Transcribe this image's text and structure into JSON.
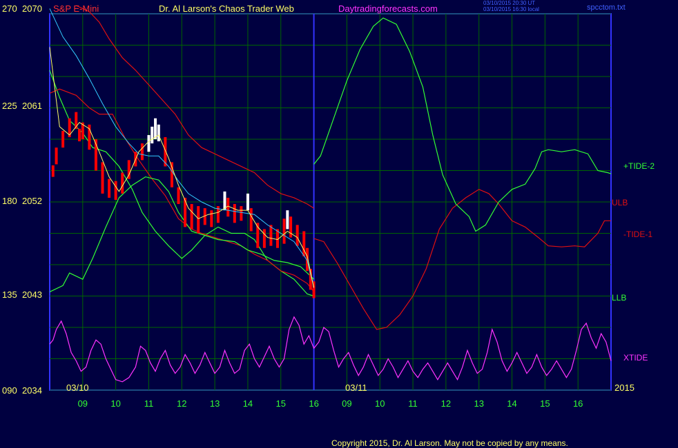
{
  "header": {
    "instrument": "S&P E-Mini",
    "title": "Dr. Al Larson's Chaos Trader Web",
    "site": "Daytradingforecasts.com",
    "stamp1": "03/10/2015 20:30 UT",
    "stamp2": "03/10/2015 16:30 local",
    "file": "spcctom.txt"
  },
  "colors": {
    "background": "#000040",
    "frame": "#3333ff",
    "grid": "#006600",
    "price_up": "#ffffff",
    "price_down": "#ff0000",
    "ma_fast": "#ffff66",
    "ma_slow": "#33ccff",
    "tide2": "#33ff33",
    "tide1": "#e01010",
    "xtide": "#ff33ff"
  },
  "footer": {
    "copyright": "Copyright 2015, Dr. Al Larson. May not be copied by any means."
  },
  "chart_data": {
    "type": "line",
    "title": "S&P E-Mini",
    "x_ticks": [
      "09",
      "10",
      "11",
      "12",
      "13",
      "14",
      "15",
      "16",
      "09",
      "10",
      "11",
      "12",
      "13",
      "14",
      "15",
      "16"
    ],
    "date_labels": [
      "03/10",
      "03/11"
    ],
    "year_label": "2015",
    "y_left_scale": [
      "270",
      "225",
      "180",
      "135",
      "090"
    ],
    "y_right_scale": [
      "2070",
      "2061",
      "2052",
      "2043",
      "2034"
    ],
    "ylim": [
      2034,
      2070
    ],
    "series_labels": {
      "tide2": "+TIDE-2",
      "ulb": "ULB",
      "tide1": "-TIDE-1",
      "llb": "LLB",
      "xtide": "XTIDE"
    },
    "grid": true,
    "price_bars": [
      [
        8.1,
        2055.5,
        2054.4,
        "down"
      ],
      [
        8.2,
        2057.2,
        2055.6,
        "down"
      ],
      [
        8.4,
        2058.8,
        2057.2,
        "down"
      ],
      [
        8.6,
        2060.0,
        2058.2,
        "down"
      ],
      [
        8.8,
        2060.6,
        2059.0,
        "down"
      ],
      [
        8.9,
        2059.0,
        2057.8,
        "down"
      ],
      [
        9.0,
        2059.6,
        2058.0,
        "down"
      ],
      [
        9.2,
        2059.4,
        2057.0,
        "down"
      ],
      [
        9.4,
        2058.0,
        2055.0,
        "down"
      ],
      [
        9.6,
        2055.8,
        2052.8,
        "down"
      ],
      [
        9.8,
        2054.2,
        2052.4,
        "down"
      ],
      [
        10.0,
        2054.0,
        2052.2,
        "down"
      ],
      [
        10.2,
        2054.8,
        2052.8,
        "down"
      ],
      [
        10.4,
        2056.0,
        2054.2,
        "down"
      ],
      [
        10.6,
        2056.8,
        2055.4,
        "down"
      ],
      [
        10.8,
        2057.6,
        2056.0,
        "down"
      ],
      [
        11.0,
        2058.4,
        2056.8,
        "up"
      ],
      [
        11.1,
        2059.2,
        2057.6,
        "up"
      ],
      [
        11.2,
        2060.0,
        2058.0,
        "up"
      ],
      [
        11.3,
        2059.4,
        2057.8,
        "up"
      ],
      [
        11.5,
        2058.2,
        2055.4,
        "down"
      ],
      [
        11.7,
        2055.8,
        2053.4,
        "down"
      ],
      [
        11.9,
        2053.4,
        2051.8,
        "down"
      ],
      [
        12.1,
        2052.4,
        2049.6,
        "down"
      ],
      [
        12.3,
        2051.8,
        2049.4,
        "down"
      ],
      [
        12.5,
        2051.6,
        2049.0,
        "down"
      ],
      [
        12.7,
        2051.4,
        2049.8,
        "down"
      ],
      [
        12.9,
        2051.2,
        2049.6,
        "down"
      ],
      [
        13.1,
        2051.6,
        2050.0,
        "down"
      ],
      [
        13.3,
        2053.0,
        2051.2,
        "up"
      ],
      [
        13.4,
        2052.4,
        2050.6,
        "down"
      ],
      [
        13.6,
        2051.8,
        2050.0,
        "down"
      ],
      [
        13.8,
        2051.6,
        2050.2,
        "down"
      ],
      [
        14.0,
        2052.8,
        2051.2,
        "up"
      ],
      [
        14.1,
        2051.4,
        2049.2,
        "down"
      ],
      [
        14.3,
        2050.0,
        2047.6,
        "down"
      ],
      [
        14.5,
        2049.4,
        2047.6,
        "down"
      ],
      [
        14.7,
        2049.8,
        2047.8,
        "down"
      ],
      [
        14.9,
        2049.4,
        2047.6,
        "down"
      ],
      [
        15.1,
        2050.4,
        2048.0,
        "down"
      ],
      [
        15.2,
        2051.2,
        2049.4,
        "up"
      ],
      [
        15.3,
        2050.6,
        2048.6,
        "down"
      ],
      [
        15.5,
        2049.8,
        2047.8,
        "down"
      ],
      [
        15.7,
        2049.2,
        2046.8,
        "down"
      ],
      [
        15.8,
        2047.6,
        2045.4,
        "down"
      ],
      [
        15.9,
        2045.6,
        2043.6,
        "down"
      ],
      [
        16.0,
        2044.4,
        2042.8,
        "down"
      ]
    ],
    "ma_fast": [
      [
        8.0,
        2066.8
      ],
      [
        8.3,
        2059.2
      ],
      [
        8.6,
        2058.4
      ],
      [
        8.9,
        2059.6
      ],
      [
        9.2,
        2059.0
      ],
      [
        9.5,
        2056.8
      ],
      [
        9.8,
        2054.4
      ],
      [
        10.1,
        2053.0
      ],
      [
        10.4,
        2054.6
      ],
      [
        10.7,
        2056.8
      ],
      [
        11.0,
        2057.8
      ],
      [
        11.3,
        2058.4
      ],
      [
        11.6,
        2056.2
      ],
      [
        11.9,
        2053.6
      ],
      [
        12.2,
        2051.4
      ],
      [
        12.5,
        2050.4
      ],
      [
        12.8,
        2050.8
      ],
      [
        13.1,
        2051.0
      ],
      [
        13.4,
        2051.6
      ],
      [
        13.7,
        2051.2
      ],
      [
        14.0,
        2051.2
      ],
      [
        14.3,
        2049.6
      ],
      [
        14.6,
        2048.6
      ],
      [
        14.9,
        2048.4
      ],
      [
        15.2,
        2049.2
      ],
      [
        15.5,
        2048.6
      ],
      [
        15.8,
        2046.8
      ],
      [
        16.0,
        2043.8
      ]
    ],
    "ma_slow": [
      [
        8.0,
        2070.5
      ],
      [
        8.4,
        2067.8
      ],
      [
        8.8,
        2066.0
      ],
      [
        9.2,
        2063.8
      ],
      [
        9.6,
        2061.4
      ],
      [
        10.0,
        2059.2
      ],
      [
        10.4,
        2057.6
      ],
      [
        10.7,
        2056.6
      ],
      [
        11.0,
        2056.4
      ],
      [
        11.3,
        2056.4
      ],
      [
        11.6,
        2055.4
      ],
      [
        11.9,
        2054.0
      ],
      [
        12.2,
        2052.8
      ],
      [
        12.6,
        2052.0
      ],
      [
        13.0,
        2051.4
      ],
      [
        13.4,
        2051.2
      ],
      [
        13.8,
        2051.0
      ],
      [
        14.2,
        2050.8
      ],
      [
        14.6,
        2049.8
      ],
      [
        15.0,
        2049.0
      ],
      [
        15.4,
        2048.2
      ],
      [
        15.8,
        2046.4
      ],
      [
        16.0,
        2043.8
      ]
    ],
    "tide2": [
      [
        8.0,
        2043.4
      ],
      [
        8.4,
        2044.0
      ],
      [
        8.6,
        2045.2
      ],
      [
        9.0,
        2044.6
      ],
      [
        9.3,
        2046.6
      ],
      [
        9.7,
        2049.6
      ],
      [
        10.1,
        2052.4
      ],
      [
        10.5,
        2053.6
      ],
      [
        10.9,
        2054.4
      ],
      [
        11.3,
        2054.1
      ],
      [
        11.6,
        2053.0
      ],
      [
        11.9,
        2051.0
      ],
      [
        12.3,
        2049.2
      ],
      [
        12.7,
        2048.8
      ],
      [
        13.1,
        2048.4
      ],
      [
        13.6,
        2048.2
      ],
      [
        14.0,
        2047.4
      ],
      [
        14.4,
        2047.0
      ],
      [
        14.8,
        2046.4
      ],
      [
        15.2,
        2046.2
      ],
      [
        15.6,
        2045.8
      ],
      [
        16.0,
        2044.6
      ],
      [
        16.0,
        2055.6
      ],
      [
        16.2,
        2056.4
      ],
      [
        16.6,
        2060.0
      ],
      [
        17.0,
        2063.6
      ],
      [
        17.4,
        2066.6
      ],
      [
        17.8,
        2068.8
      ],
      [
        18.1,
        2069.6
      ],
      [
        18.5,
        2069.0
      ],
      [
        18.9,
        2066.4
      ],
      [
        19.3,
        2063.0
      ],
      [
        19.6,
        2058.4
      ],
      [
        19.9,
        2054.6
      ],
      [
        20.3,
        2051.8
      ],
      [
        20.7,
        2050.6
      ],
      [
        20.9,
        2049.2
      ],
      [
        21.2,
        2049.8
      ],
      [
        21.6,
        2052.0
      ],
      [
        22.0,
        2053.2
      ],
      [
        22.4,
        2053.7
      ],
      [
        22.7,
        2055.2
      ],
      [
        22.9,
        2056.8
      ],
      [
        23.1,
        2057.0
      ],
      [
        23.5,
        2056.8
      ],
      [
        23.9,
        2057.0
      ],
      [
        24.3,
        2056.6
      ],
      [
        24.6,
        2055.0
      ],
      [
        24.9,
        2054.8
      ],
      [
        25.0,
        2054.7
      ]
    ],
    "tide1": [
      [
        8.0,
        2062.4
      ],
      [
        8.3,
        2062.8
      ],
      [
        8.8,
        2062.2
      ],
      [
        9.2,
        2061.0
      ],
      [
        9.5,
        2060.4
      ],
      [
        9.9,
        2060.4
      ],
      [
        10.3,
        2058.0
      ],
      [
        10.7,
        2056.0
      ],
      [
        11.1,
        2054.2
      ],
      [
        11.5,
        2052.6
      ],
      [
        11.9,
        2050.4
      ],
      [
        12.3,
        2049.4
      ],
      [
        12.6,
        2049.0
      ],
      [
        13.0,
        2048.6
      ],
      [
        13.4,
        2048.2
      ],
      [
        13.8,
        2047.8
      ],
      [
        14.2,
        2047.0
      ],
      [
        14.6,
        2046.4
      ],
      [
        15.0,
        2045.4
      ],
      [
        15.4,
        2045.0
      ],
      [
        15.8,
        2044.2
      ],
      [
        16.0,
        2043.4
      ],
      [
        16.0,
        2048.5
      ],
      [
        16.3,
        2048.2
      ],
      [
        16.7,
        2046.2
      ],
      [
        17.1,
        2044.0
      ],
      [
        17.5,
        2041.8
      ],
      [
        17.9,
        2039.8
      ],
      [
        18.2,
        2040.0
      ],
      [
        18.6,
        2041.2
      ],
      [
        19.0,
        2043.0
      ],
      [
        19.4,
        2045.6
      ],
      [
        19.8,
        2049.4
      ],
      [
        20.2,
        2051.4
      ],
      [
        20.6,
        2052.4
      ],
      [
        21.0,
        2053.2
      ],
      [
        21.3,
        2052.8
      ],
      [
        21.6,
        2051.8
      ],
      [
        22.0,
        2050.2
      ],
      [
        22.4,
        2049.6
      ],
      [
        22.8,
        2048.6
      ],
      [
        23.1,
        2047.8
      ],
      [
        23.5,
        2047.7
      ],
      [
        23.9,
        2047.8
      ],
      [
        24.2,
        2047.7
      ],
      [
        24.6,
        2049.0
      ],
      [
        24.8,
        2050.2
      ],
      [
        25.0,
        2050.2
      ]
    ],
    "ulb": [
      [
        8.8,
        2070.8
      ],
      [
        9.2,
        2070.2
      ],
      [
        9.5,
        2069.2
      ],
      [
        9.8,
        2067.6
      ],
      [
        10.2,
        2065.8
      ],
      [
        10.6,
        2064.6
      ],
      [
        11.0,
        2063.2
      ],
      [
        11.4,
        2061.8
      ],
      [
        11.8,
        2060.4
      ],
      [
        12.2,
        2058.4
      ],
      [
        12.6,
        2057.2
      ],
      [
        13.0,
        2056.6
      ],
      [
        13.4,
        2056.0
      ],
      [
        13.8,
        2055.4
      ],
      [
        14.2,
        2054.8
      ],
      [
        14.6,
        2053.6
      ],
      [
        15.0,
        2052.8
      ],
      [
        15.4,
        2052.4
      ],
      [
        15.8,
        2051.8
      ],
      [
        16.0,
        2051.4
      ]
    ],
    "llb": [
      [
        8.0,
        2064.6
      ],
      [
        8.3,
        2062.0
      ],
      [
        8.6,
        2059.8
      ],
      [
        9.0,
        2058.6
      ],
      [
        9.3,
        2057.2
      ],
      [
        9.7,
        2056.8
      ],
      [
        10.1,
        2055.4
      ],
      [
        10.5,
        2053.2
      ],
      [
        10.8,
        2051.0
      ],
      [
        11.2,
        2049.2
      ],
      [
        11.6,
        2047.8
      ],
      [
        12.0,
        2046.6
      ],
      [
        12.3,
        2047.4
      ],
      [
        12.7,
        2048.8
      ],
      [
        13.1,
        2049.6
      ],
      [
        13.5,
        2049.0
      ],
      [
        13.9,
        2049.0
      ],
      [
        14.2,
        2048.4
      ],
      [
        14.6,
        2046.4
      ],
      [
        15.0,
        2045.4
      ],
      [
        15.4,
        2044.6
      ],
      [
        15.8,
        2043.2
      ],
      [
        16.0,
        2043.0
      ]
    ],
    "xtide": [
      [
        8.0,
        2038.4
      ],
      [
        8.1,
        2038.8
      ],
      [
        8.2,
        2039.8
      ],
      [
        8.35,
        2040.6
      ],
      [
        8.5,
        2039.4
      ],
      [
        8.65,
        2037.6
      ],
      [
        8.8,
        2036.8
      ],
      [
        8.95,
        2035.8
      ],
      [
        9.1,
        2036.2
      ],
      [
        9.25,
        2037.8
      ],
      [
        9.4,
        2038.8
      ],
      [
        9.55,
        2038.4
      ],
      [
        9.7,
        2037.0
      ],
      [
        9.85,
        2036.0
      ],
      [
        10.0,
        2035.0
      ],
      [
        10.2,
        2034.8
      ],
      [
        10.4,
        2035.2
      ],
      [
        10.6,
        2036.2
      ],
      [
        10.75,
        2038.2
      ],
      [
        10.9,
        2037.8
      ],
      [
        11.05,
        2036.6
      ],
      [
        11.2,
        2035.8
      ],
      [
        11.35,
        2037.0
      ],
      [
        11.5,
        2037.8
      ],
      [
        11.65,
        2036.4
      ],
      [
        11.8,
        2035.6
      ],
      [
        11.95,
        2036.2
      ],
      [
        12.1,
        2037.4
      ],
      [
        12.25,
        2036.6
      ],
      [
        12.4,
        2035.6
      ],
      [
        12.55,
        2036.4
      ],
      [
        12.7,
        2037.6
      ],
      [
        12.85,
        2036.6
      ],
      [
        13.0,
        2035.6
      ],
      [
        13.15,
        2036.2
      ],
      [
        13.3,
        2037.8
      ],
      [
        13.45,
        2036.6
      ],
      [
        13.6,
        2035.6
      ],
      [
        13.75,
        2036.0
      ],
      [
        13.9,
        2037.8
      ],
      [
        14.05,
        2038.4
      ],
      [
        14.2,
        2037.0
      ],
      [
        14.35,
        2036.2
      ],
      [
        14.5,
        2037.2
      ],
      [
        14.65,
        2038.2
      ],
      [
        14.8,
        2037.0
      ],
      [
        14.95,
        2036.2
      ],
      [
        15.1,
        2037.0
      ],
      [
        15.25,
        2039.8
      ],
      [
        15.4,
        2041.0
      ],
      [
        15.55,
        2040.2
      ],
      [
        15.7,
        2038.4
      ],
      [
        15.85,
        2039.2
      ],
      [
        16.0,
        2038.0
      ],
      [
        16.15,
        2038.6
      ],
      [
        16.3,
        2040.0
      ],
      [
        16.45,
        2039.6
      ],
      [
        16.6,
        2037.8
      ],
      [
        16.75,
        2036.2
      ],
      [
        16.9,
        2037.0
      ],
      [
        17.05,
        2037.6
      ],
      [
        17.2,
        2036.4
      ],
      [
        17.35,
        2035.4
      ],
      [
        17.5,
        2036.2
      ],
      [
        17.65,
        2037.4
      ],
      [
        17.8,
        2036.4
      ],
      [
        17.95,
        2035.4
      ],
      [
        18.1,
        2036.0
      ],
      [
        18.25,
        2037.0
      ],
      [
        18.4,
        2036.2
      ],
      [
        18.55,
        2035.2
      ],
      [
        18.7,
        2036.0
      ],
      [
        18.85,
        2036.8
      ],
      [
        19.0,
        2035.8
      ],
      [
        19.15,
        2035.2
      ],
      [
        19.3,
        2036.0
      ],
      [
        19.45,
        2036.6
      ],
      [
        19.6,
        2035.8
      ],
      [
        19.75,
        2035.0
      ],
      [
        19.9,
        2035.8
      ],
      [
        20.05,
        2036.6
      ],
      [
        20.2,
        2035.8
      ],
      [
        20.35,
        2035.0
      ],
      [
        20.5,
        2036.2
      ],
      [
        20.65,
        2037.8
      ],
      [
        20.8,
        2036.6
      ],
      [
        20.95,
        2035.6
      ],
      [
        21.1,
        2036.0
      ],
      [
        21.25,
        2037.6
      ],
      [
        21.4,
        2039.8
      ],
      [
        21.55,
        2038.6
      ],
      [
        21.7,
        2036.8
      ],
      [
        21.85,
        2035.8
      ],
      [
        22.0,
        2036.6
      ],
      [
        22.15,
        2037.6
      ],
      [
        22.3,
        2036.6
      ],
      [
        22.45,
        2035.6
      ],
      [
        22.6,
        2036.2
      ],
      [
        22.75,
        2037.4
      ],
      [
        22.9,
        2036.2
      ],
      [
        23.05,
        2035.4
      ],
      [
        23.2,
        2036.0
      ],
      [
        23.35,
        2036.8
      ],
      [
        23.5,
        2036.0
      ],
      [
        23.65,
        2035.2
      ],
      [
        23.8,
        2036.0
      ],
      [
        23.95,
        2037.8
      ],
      [
        24.1,
        2039.8
      ],
      [
        24.25,
        2040.4
      ],
      [
        24.4,
        2039.0
      ],
      [
        24.55,
        2038.0
      ],
      [
        24.7,
        2039.4
      ],
      [
        24.85,
        2038.6
      ],
      [
        25.0,
        2036.8
      ]
    ]
  }
}
